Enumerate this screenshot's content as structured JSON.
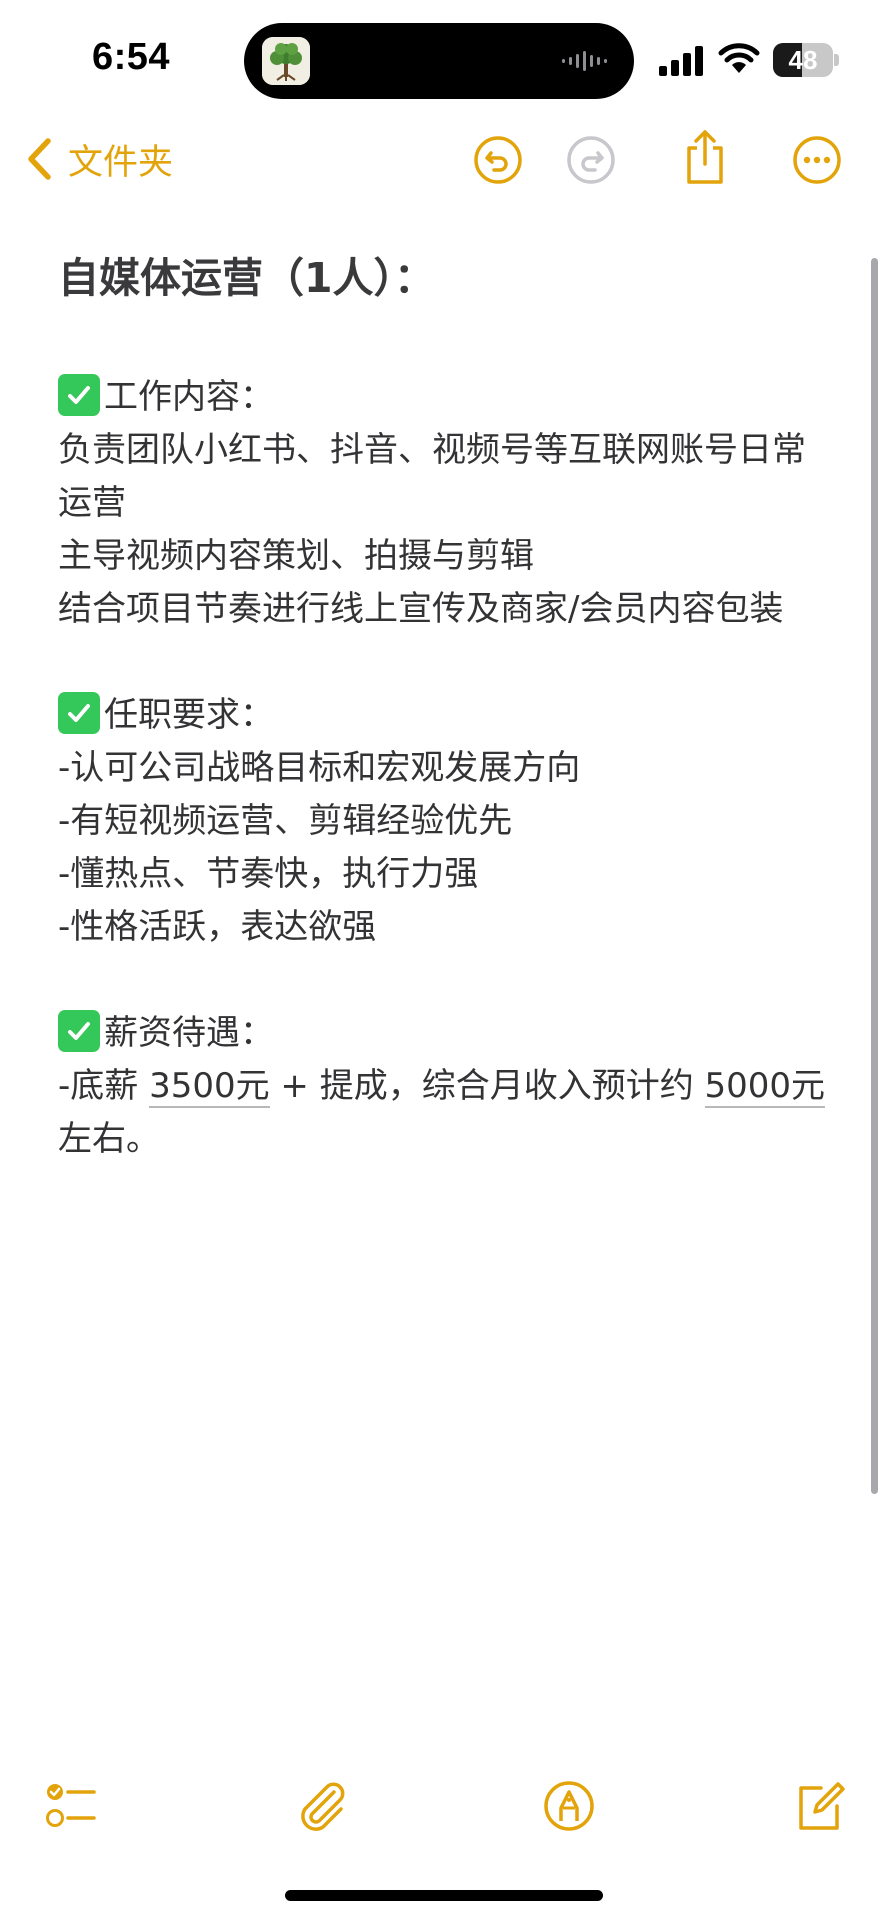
{
  "status_bar": {
    "time": "6:54",
    "battery_level": "48",
    "battery_fraction": 0.48
  },
  "nav": {
    "back_label": "文件夹",
    "icons": [
      "chevron-left-icon",
      "undo-icon",
      "redo-icon",
      "share-icon",
      "more-icon"
    ]
  },
  "note": {
    "title": "自媒体运营（1人）：",
    "section1_heading": "工作内容：",
    "section1_lines": [
      "负责团队小红书、抖音、视频号等互联网账号日常运营",
      "主导视频内容策划、拍摄与剪辑",
      "结合项目节奏进行线上宣传及商家/会员内容包装"
    ],
    "section2_heading": "任职要求：",
    "section2_lines": [
      "-认可公司战略目标和宏观发展方向",
      "-有短视频运营、剪辑经验优先",
      "-懂热点、节奏快，执行力强",
      "-性格活跃，表达欲强"
    ],
    "section3_heading": "薪资待遇：",
    "salary": {
      "prefix": "-底薪 ",
      "base": "3500元",
      "middle": " + 提成，综合月收入预计约 ",
      "total": "5000元",
      "suffix": "左右。"
    }
  },
  "toolbar": {
    "icons": [
      "checklist-icon",
      "paperclip-icon",
      "markup-pen-icon",
      "compose-icon"
    ]
  },
  "colors": {
    "accent": "#e3a40b",
    "check_green": "#34c759",
    "text": "#333336"
  }
}
